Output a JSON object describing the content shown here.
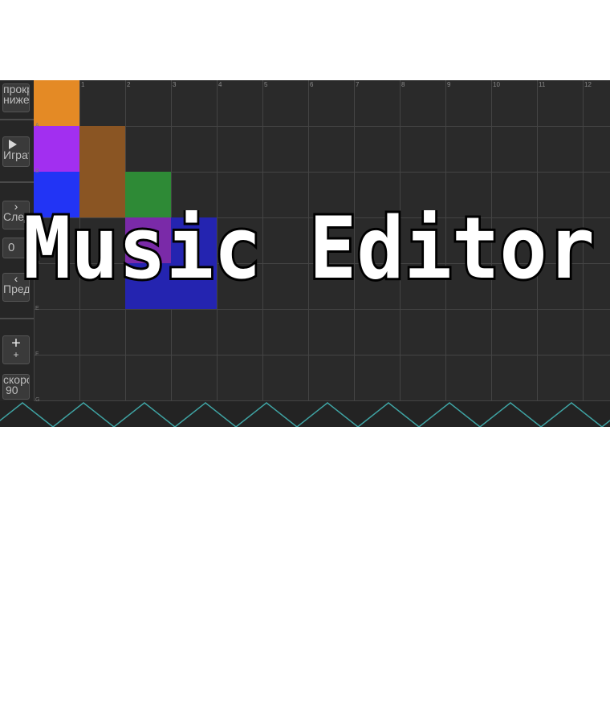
{
  "app": {
    "title": "Music Editor"
  },
  "sidebar": {
    "scroll_down_label": "прокрутить ниже",
    "play_label": "Играть",
    "next_label": "След",
    "prev_label": "Пред",
    "page_value": "0",
    "add_icon": "plus-icon",
    "tempo_label": "скорость",
    "tempo_value": "90"
  },
  "grid": {
    "columns": [
      "1",
      "2",
      "3",
      "4",
      "5",
      "6",
      "7",
      "8",
      "9",
      "10",
      "11",
      "12"
    ],
    "rows": [
      "A",
      "B",
      "C",
      "D",
      "E",
      "F",
      "G"
    ],
    "notes": [
      {
        "col": 0,
        "row": 0,
        "color": "#e48a25"
      },
      {
        "col": 0,
        "row": 1,
        "color": "#a22ff0"
      },
      {
        "col": 1,
        "row": 1,
        "color": "#8a5523"
      },
      {
        "col": 0,
        "row": 2,
        "color": "#2234f5"
      },
      {
        "col": 1,
        "row": 2,
        "color": "#8a5523"
      },
      {
        "col": 2,
        "row": 2,
        "color": "#2e8a36"
      },
      {
        "col": 2,
        "row": 3,
        "color": "#7a2aa8"
      },
      {
        "col": 3,
        "row": 3,
        "color": "#2424b0"
      },
      {
        "col": 2,
        "row": 4,
        "color": "#2424b0"
      },
      {
        "col": 3,
        "row": 4,
        "color": "#2424b0"
      }
    ]
  },
  "colors": {
    "background": "#2a2a2a",
    "grid_line": "#444444",
    "wave": "#3fa3a3",
    "title_fill": "#ffffff",
    "title_outline": "#000000"
  }
}
